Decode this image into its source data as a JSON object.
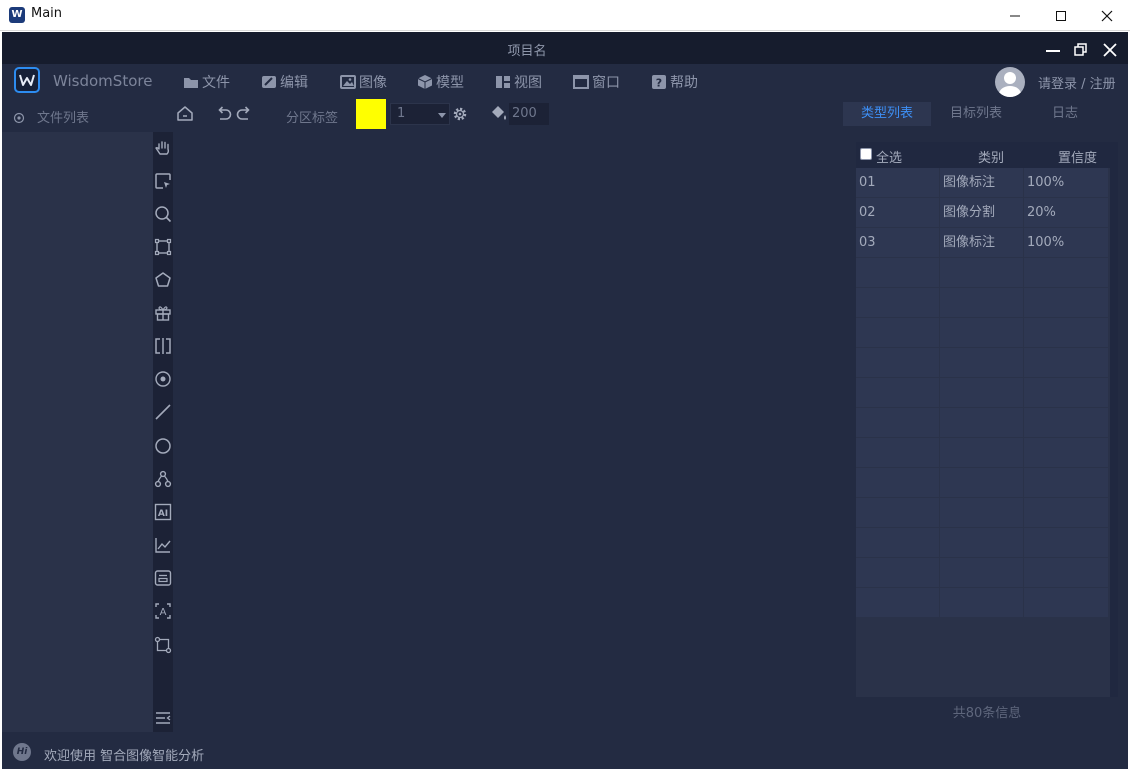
{
  "window": {
    "title": "Main"
  },
  "app": {
    "project_title": "项目名",
    "brand": "WisdomStore",
    "menu": [
      {
        "label": "文件",
        "icon": "folder-icon"
      },
      {
        "label": "编辑",
        "icon": "edit-icon"
      },
      {
        "label": "图像",
        "icon": "image-icon"
      },
      {
        "label": "模型",
        "icon": "cube-icon"
      },
      {
        "label": "视图",
        "icon": "layout-icon"
      },
      {
        "label": "窗口",
        "icon": "window-icon"
      },
      {
        "label": "帮助",
        "icon": "help-icon"
      }
    ],
    "login_text": "请登录 / 注册"
  },
  "toolbar": {
    "file_list_label": "文件列表",
    "partition_label": "分区标签",
    "label_color": "#ffff00",
    "label_value": "1",
    "fill_value": "200"
  },
  "right_panel": {
    "tabs": [
      "类型列表",
      "目标列表",
      "日志"
    ],
    "active_tab": "类型列表",
    "table": {
      "select_all_label": "全选",
      "columns": [
        "类别",
        "置信度"
      ],
      "rows": [
        {
          "id": "01",
          "category": "图像标注",
          "confidence": "100%"
        },
        {
          "id": "02",
          "category": "图像分割",
          "confidence": "20%"
        },
        {
          "id": "03",
          "category": "图像标注",
          "confidence": "100%"
        }
      ],
      "empty_rows": 12
    },
    "footer": "共80条信息"
  },
  "tools": [
    "hand-icon",
    "select-icon",
    "zoom-icon",
    "rectangle-icon",
    "polygon-icon",
    "gift-icon",
    "split-icon",
    "point-icon",
    "line-icon",
    "circle-icon",
    "link-icon",
    "ai-icon",
    "chart-icon",
    "form-icon",
    "transform-icon",
    "crop-icon"
  ],
  "status": {
    "text": "欢迎使用 智合图像智能分析",
    "badge": "Hi"
  },
  "colors": {
    "accent": "#3d8ff5",
    "background": "#232b42",
    "panel": "#2a3249"
  }
}
